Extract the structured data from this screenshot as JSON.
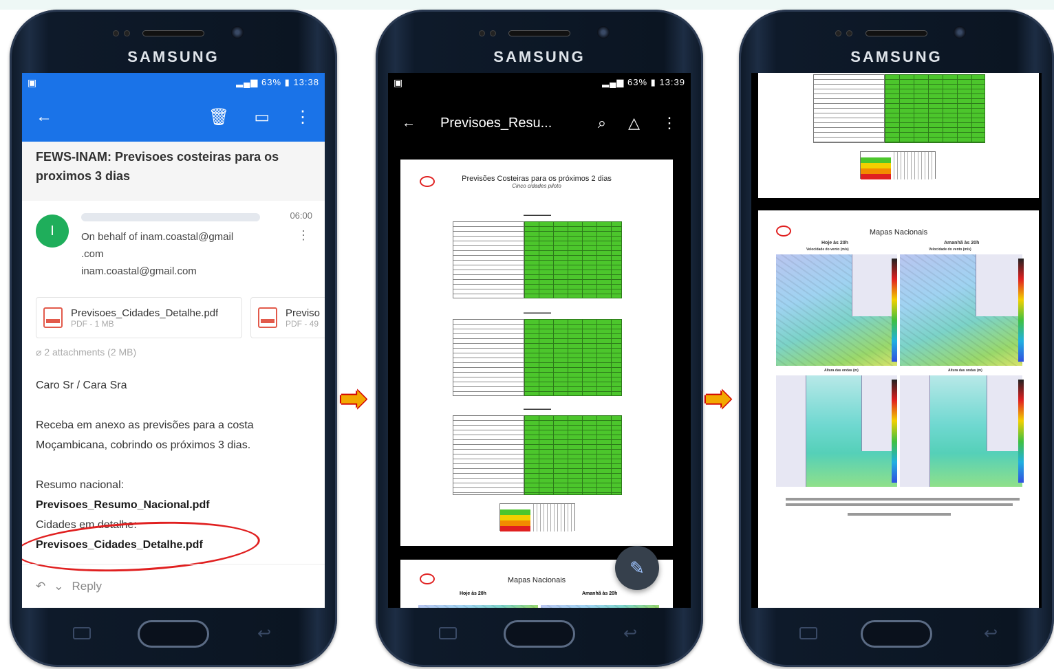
{
  "brand": "SAMSUNG",
  "phone1": {
    "status": {
      "time": "13:38",
      "battery": "63%"
    },
    "subject": "FEWS-INAM: Previsoes costeiras para os proximos 3 dias",
    "avatar_letter": "I",
    "time": "06:00",
    "behalf_line1": "On behalf of inam.coastal@gmail",
    "behalf_line2": ".com",
    "sender_email": "inam.coastal@gmail.com",
    "attachments": [
      {
        "name": "Previsoes_Cidades_Detalhe.pdf",
        "meta": "PDF - 1 MB"
      },
      {
        "name": "Previso",
        "meta": "PDF - 49"
      }
    ],
    "attachment_count": "2 attachments (2 MB)",
    "greeting": "Caro Sr / Cara Sra",
    "message_line1": "Receba em anexo as previsões para a costa",
    "message_line2": "Moçambicana, cobrindo os próximos 3 dias.",
    "resumo_label": "Resumo nacional:",
    "resumo_file": "Previsoes_Resumo_Nacional.pdf",
    "cidades_label": "Cidades em detalhe:",
    "cidades_file": "Previsoes_Cidades_Detalhe.pdf",
    "reply_label": "Reply"
  },
  "phone2": {
    "status": {
      "time": "13:39",
      "battery": "63%"
    },
    "file_title": "Previsoes_Resu...",
    "doc_title": "Previsões Costeiras para os próximos 2 dias",
    "doc_subtitle": "Cinco cidades piloto",
    "page2_title": "Mapas Nacionais",
    "map_left_title": "Hoje às 20h",
    "map_right_title": "Amanhã às 20h",
    "map_sub": "Velocidade do vento (m/s)"
  },
  "phone3": {
    "page_title": "Mapas Nacionais",
    "map_left_title": "Hoje às 20h",
    "map_right_title": "Amanhã às 20h",
    "wind_sub": "Velocidade do vento (m/s)",
    "wave_sub": "Altura das ondas (m)"
  },
  "colors": {
    "gmail_blue": "#1a73e8",
    "table_green": "#4cc62c",
    "highlight_red": "#e02020",
    "arrow_orange": "#f2a800"
  }
}
